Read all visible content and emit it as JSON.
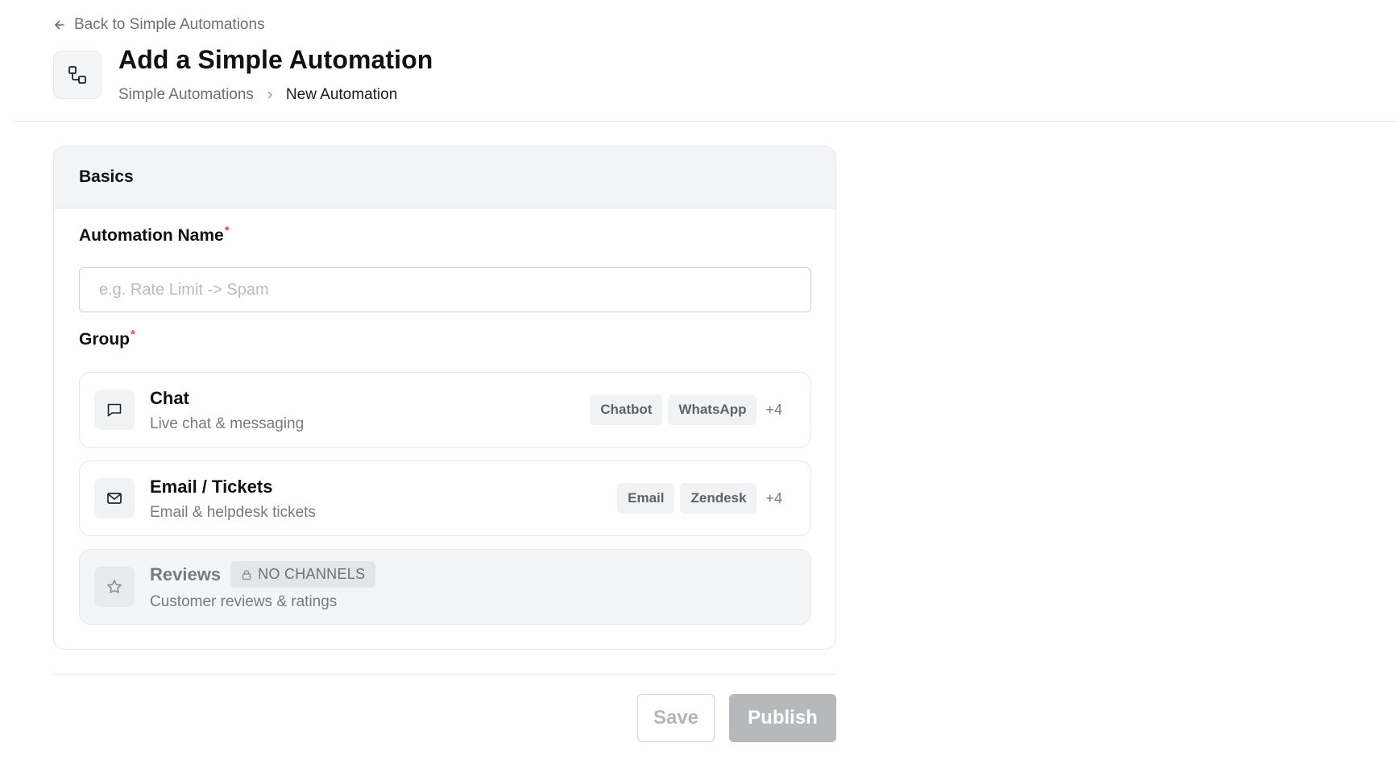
{
  "header": {
    "back_label": "Back to Simple Automations",
    "title": "Add a Simple Automation",
    "breadcrumb": {
      "parent": "Simple Automations",
      "current": "New Automation"
    }
  },
  "card": {
    "title": "Basics",
    "name_field": {
      "label": "Automation Name",
      "required_mark": "*",
      "value": "",
      "placeholder": "e.g. Rate Limit -> Spam"
    },
    "group_field": {
      "label": "Group",
      "required_mark": "*",
      "options": [
        {
          "icon": "message-square-icon",
          "title": "Chat",
          "description": "Live chat & messaging",
          "tags": [
            "Chatbot",
            "WhatsApp"
          ],
          "more": "+4",
          "disabled": false
        },
        {
          "icon": "mail-icon",
          "title": "Email / Tickets",
          "description": "Email & helpdesk tickets",
          "tags": [
            "Email",
            "Zendesk"
          ],
          "more": "+4",
          "disabled": false
        },
        {
          "icon": "star-icon",
          "title": "Reviews",
          "badge": "NO CHANNELS",
          "description": "Customer reviews & ratings",
          "disabled": true
        }
      ]
    }
  },
  "footer": {
    "save_label": "Save",
    "publish_label": "Publish"
  },
  "colors": {
    "required": "#e5484d",
    "card_header_bg": "#f3f4f5",
    "disabled_button": "#b7b8ba"
  }
}
